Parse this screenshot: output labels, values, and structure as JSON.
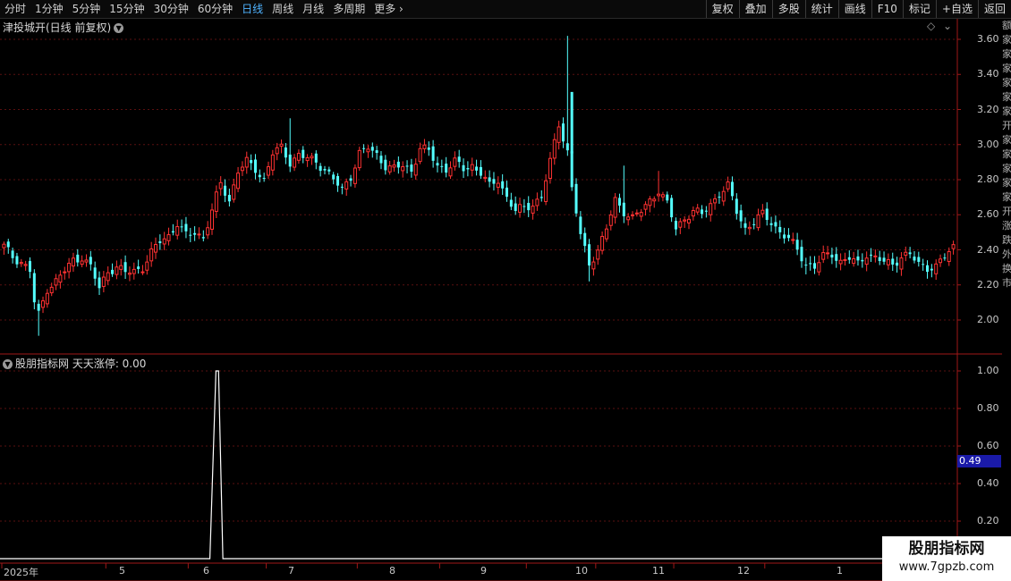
{
  "periods": {
    "items": [
      "分时",
      "1分钟",
      "5分钟",
      "15分钟",
      "30分钟",
      "60分钟",
      "日线",
      "周线",
      "月线",
      "多周期",
      "更多"
    ],
    "active_index": 6
  },
  "tools": [
    "复权",
    "叠加",
    "多股",
    "统计",
    "画线",
    "F10",
    "标记",
    "+自选",
    "返回"
  ],
  "main_pane": {
    "title": "津投城开(日线 前复权)",
    "y_ticks": [
      "3.60",
      "3.40",
      "3.20",
      "3.00",
      "2.80",
      "2.60",
      "2.40",
      "2.20",
      "2.00"
    ]
  },
  "indicator_pane": {
    "title": "股朋指标网 天天涨停: 0.00",
    "y_ticks": [
      "1.00",
      "0.80",
      "0.60",
      "0.40",
      "0.20"
    ],
    "current_value": "0.49"
  },
  "x_axis": [
    "2025年",
    "5",
    "6",
    "7",
    "8",
    "9",
    "10",
    "11",
    "12",
    "1"
  ],
  "right_strip": [
    "额",
    "家",
    "家",
    "家",
    "家",
    "家",
    "家",
    "开",
    "家",
    "家",
    "家",
    "家",
    "家",
    "开",
    "涨",
    "跌",
    "外",
    "换",
    "市"
  ],
  "watermark": {
    "line1": "股朋指标网",
    "line2": "www.7gpzb.com"
  },
  "colors": {
    "up": "#ff3232",
    "down": "#54ffff",
    "grid": "#5a1010",
    "axis": "#a01818",
    "signal": "#ffffff"
  },
  "chart_data": [
    {
      "type": "candlestick",
      "title": "津投城开(日线 前复权)",
      "ylim": [
        1.9,
        3.7
      ],
      "x_labels": [
        "2025年",
        "5",
        "6",
        "7",
        "8",
        "9",
        "10",
        "11",
        "12",
        "1"
      ],
      "close_path": [
        [
          0,
          2.42
        ],
        [
          2,
          2.36
        ],
        [
          4,
          2.33
        ],
        [
          6,
          2.28
        ],
        [
          7,
          2.1
        ],
        [
          8,
          2.03
        ],
        [
          10,
          2.18
        ],
        [
          12,
          2.22
        ],
        [
          14,
          2.28
        ],
        [
          16,
          2.34
        ],
        [
          18,
          2.36
        ],
        [
          20,
          2.3
        ],
        [
          22,
          2.18
        ],
        [
          24,
          2.28
        ],
        [
          26,
          2.3
        ],
        [
          28,
          2.27
        ],
        [
          30,
          2.28
        ],
        [
          32,
          2.3
        ],
        [
          34,
          2.38
        ],
        [
          36,
          2.45
        ],
        [
          38,
          2.48
        ],
        [
          40,
          2.55
        ],
        [
          42,
          2.48
        ],
        [
          44,
          2.5
        ],
        [
          46,
          2.47
        ],
        [
          48,
          2.62
        ],
        [
          50,
          2.78
        ],
        [
          52,
          2.68
        ],
        [
          54,
          2.85
        ],
        [
          56,
          2.9
        ],
        [
          58,
          2.86
        ],
        [
          60,
          2.8
        ],
        [
          62,
          2.95
        ],
        [
          64,
          2.98
        ],
        [
          66,
          2.9
        ],
        [
          68,
          2.94
        ],
        [
          70,
          2.92
        ],
        [
          72,
          2.9
        ],
        [
          74,
          2.86
        ],
        [
          76,
          2.8
        ],
        [
          78,
          2.74
        ],
        [
          80,
          2.82
        ],
        [
          82,
          2.95
        ],
        [
          84,
          2.98
        ],
        [
          86,
          2.94
        ],
        [
          88,
          2.88
        ],
        [
          90,
          2.86
        ],
        [
          92,
          2.88
        ],
        [
          94,
          2.85
        ],
        [
          96,
          2.98
        ],
        [
          98,
          2.96
        ],
        [
          100,
          2.88
        ],
        [
          102,
          2.86
        ],
        [
          104,
          2.9
        ],
        [
          106,
          2.86
        ],
        [
          108,
          2.88
        ],
        [
          110,
          2.84
        ],
        [
          112,
          2.76
        ],
        [
          114,
          2.8
        ],
        [
          116,
          2.7
        ],
        [
          118,
          2.62
        ],
        [
          120,
          2.64
        ],
        [
          122,
          2.66
        ],
        [
          124,
          2.7
        ],
        [
          126,
          2.9
        ],
        [
          128,
          3.12
        ],
        [
          130,
          2.96
        ],
        [
          131,
          2.75
        ],
        [
          133,
          2.48
        ],
        [
          135,
          2.32
        ],
        [
          137,
          2.4
        ],
        [
          139,
          2.52
        ],
        [
          141,
          2.68
        ],
        [
          143,
          2.62
        ],
        [
          145,
          2.58
        ],
        [
          147,
          2.62
        ],
        [
          149,
          2.68
        ],
        [
          151,
          2.74
        ],
        [
          153,
          2.66
        ],
        [
          155,
          2.52
        ],
        [
          157,
          2.58
        ],
        [
          159,
          2.62
        ],
        [
          161,
          2.6
        ],
        [
          163,
          2.66
        ],
        [
          165,
          2.72
        ],
        [
          167,
          2.76
        ],
        [
          169,
          2.62
        ],
        [
          171,
          2.52
        ],
        [
          173,
          2.56
        ],
        [
          175,
          2.6
        ],
        [
          177,
          2.56
        ],
        [
          179,
          2.5
        ],
        [
          181,
          2.46
        ],
        [
          183,
          2.4
        ],
        [
          185,
          2.32
        ],
        [
          187,
          2.3
        ],
        [
          189,
          2.36
        ],
        [
          191,
          2.38
        ],
        [
          193,
          2.33
        ],
        [
          195,
          2.35
        ],
        [
          197,
          2.32
        ],
        [
          199,
          2.38
        ],
        [
          201,
          2.35
        ],
        [
          203,
          2.33
        ],
        [
          205,
          2.32
        ],
        [
          207,
          2.36
        ],
        [
          209,
          2.37
        ],
        [
          211,
          2.32
        ],
        [
          213,
          2.3
        ],
        [
          215,
          2.3
        ],
        [
          217,
          2.36
        ],
        [
          219,
          2.42
        ]
      ],
      "spikes": [
        [
          130,
          3.62
        ],
        [
          8,
          1.91
        ],
        [
          135,
          2.22
        ],
        [
          66,
          3.15
        ],
        [
          143,
          2.88
        ],
        [
          151,
          2.85
        ],
        [
          185,
          2.26
        ]
      ]
    },
    {
      "type": "line",
      "title": "天天涨停",
      "ylim": [
        0,
        1.05
      ],
      "series": [
        {
          "name": "天天涨停",
          "x": [
            0,
            48,
            49,
            50,
            51,
            219
          ],
          "y": [
            0,
            0,
            1.0,
            1.0,
            0,
            0
          ]
        }
      ]
    }
  ]
}
